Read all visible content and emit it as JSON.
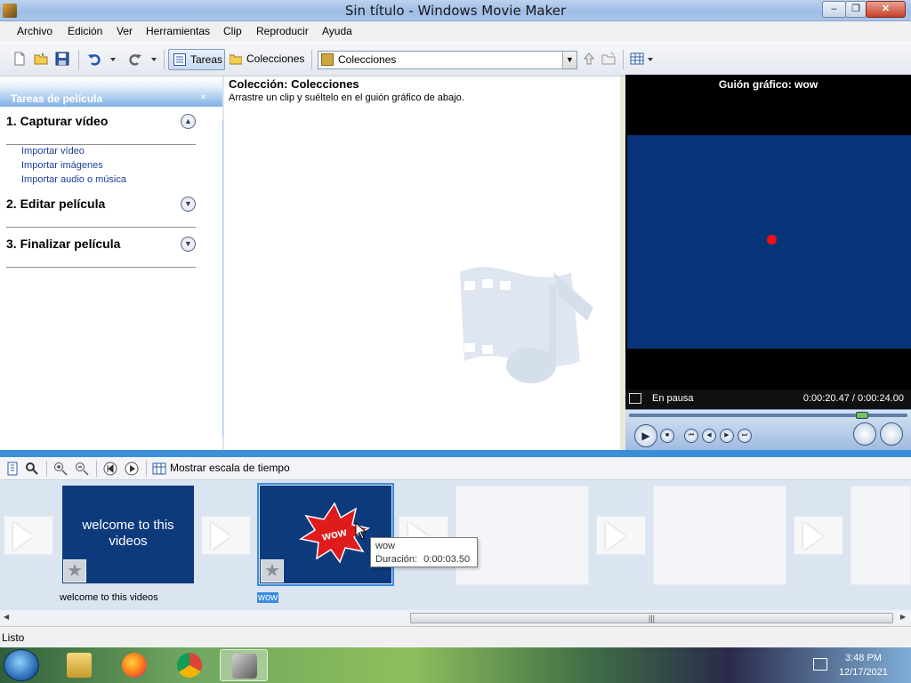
{
  "window": {
    "title": "Sin título - Windows Movie Maker",
    "minimize": "–",
    "restore": "❐",
    "close": "✕"
  },
  "menu": [
    "Archivo",
    "Edición",
    "Ver",
    "Herramientas",
    "Clip",
    "Reproducir",
    "Ayuda"
  ],
  "toolbar": {
    "tasks_label": "Tareas",
    "collections_label": "Colecciones",
    "collection_select": "Colecciones"
  },
  "tasks_pane": {
    "header": "Tareas de película",
    "close": "×",
    "sections": [
      {
        "title": "1. Capturar vídeo",
        "links": [
          "Importar vídeo",
          "Importar imágenes",
          "Importar audio o música"
        ]
      },
      {
        "title": "2. Editar película",
        "links": []
      },
      {
        "title": "3. Finalizar película",
        "links": []
      }
    ]
  },
  "collection": {
    "title": "Colección: Colecciones",
    "hint": "Arrastre un clip y suéltelo en el guión gráfico de abajo."
  },
  "monitor": {
    "title": "Guión gráfico: wow",
    "status": "En pausa",
    "time": "0:00:20.47 / 0:00:24.00",
    "seek_fraction": 0.853
  },
  "storyboard_toolbar": {
    "show_timeline": "Mostrar escala de tiempo"
  },
  "storyboard": {
    "clips": [
      {
        "text": "welcome to this videos",
        "caption": "welcome to this videos"
      },
      {
        "text": "wow",
        "caption": "wow"
      }
    ],
    "tooltip": {
      "name": "wow",
      "duration_label": "Duración:",
      "duration": "0:00:03.50"
    }
  },
  "statusbar": {
    "text": "Listo"
  },
  "taskbar": {
    "time": "3:48 PM",
    "date": "12/17/2021"
  },
  "colors": {
    "accent": "#3a8fd8",
    "monitor_screen": "#083479",
    "clip_bg": "#0c3a7c",
    "wow_burst": "#e01b1b"
  }
}
